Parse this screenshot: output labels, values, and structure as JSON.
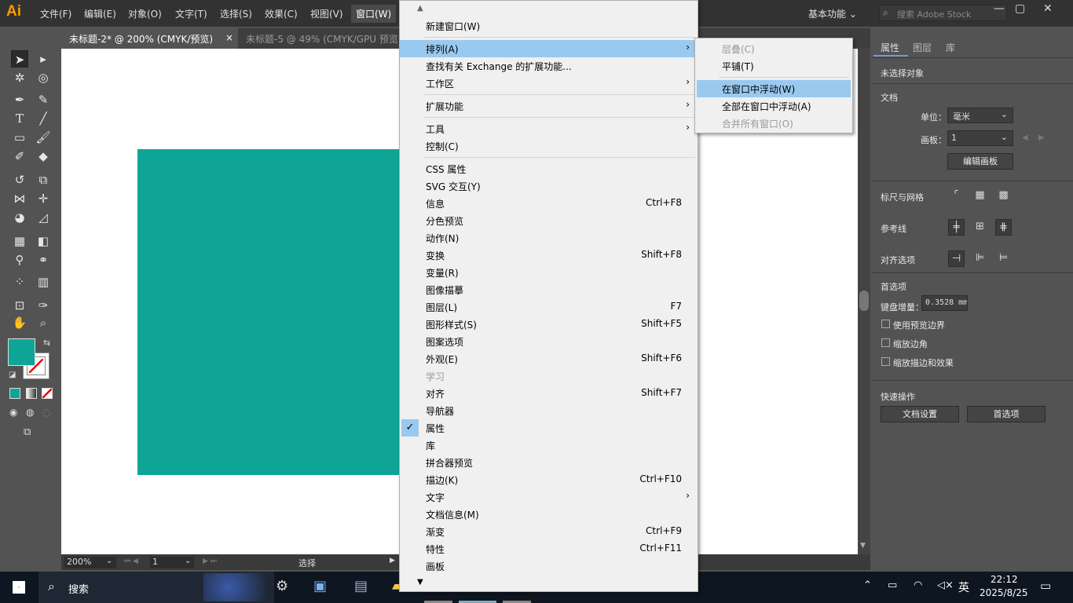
{
  "app": {
    "logo": "Ai"
  },
  "menubar": {
    "items": [
      "文件(F)",
      "编辑(E)",
      "对象(O)",
      "文字(T)",
      "选择(S)",
      "效果(C)",
      "视图(V)",
      "窗口(W)"
    ],
    "workspace": "基本功能",
    "search_placeholder": "搜索 Adobe Stock"
  },
  "tabs": [
    {
      "label": "未标题-2* @ 200% (CMYK/预览)",
      "close": "×"
    },
    {
      "label": "未标题-5 @ 49% (CMYK/GPU 预览"
    }
  ],
  "colors": {
    "fill": "#0ea596",
    "accent": "#99c9ef",
    "menu_bg": "#f0f0f0"
  },
  "statusbar": {
    "zoom": "200%",
    "artboard": "1",
    "tool": "选择"
  },
  "window_menu": {
    "items": [
      {
        "label": "新建窗口(W)",
        "shortcut": "",
        "sub": false
      },
      {
        "label": "排列(A)",
        "shortcut": "",
        "sub": true
      },
      {
        "label": "查找有关 Exchange 的扩展功能...",
        "shortcut": "",
        "sub": false
      },
      {
        "label": "工作区",
        "shortcut": "",
        "sub": true
      },
      {
        "label": "扩展功能",
        "shortcut": "",
        "sub": true
      },
      {
        "label": "工具",
        "shortcut": "",
        "sub": true
      },
      {
        "label": "控制(C)",
        "shortcut": "",
        "sub": false
      },
      {
        "label": "CSS 属性",
        "shortcut": "",
        "sub": false
      },
      {
        "label": "SVG 交互(Y)",
        "shortcut": "",
        "sub": false
      },
      {
        "label": "信息",
        "shortcut": "Ctrl+F8",
        "sub": false
      },
      {
        "label": "分色预览",
        "shortcut": "",
        "sub": false
      },
      {
        "label": "动作(N)",
        "shortcut": "",
        "sub": false
      },
      {
        "label": "变换",
        "shortcut": "Shift+F8",
        "sub": false
      },
      {
        "label": "变量(R)",
        "shortcut": "",
        "sub": false
      },
      {
        "label": "图像描摹",
        "shortcut": "",
        "sub": false
      },
      {
        "label": "图层(L)",
        "shortcut": "F7",
        "sub": false
      },
      {
        "label": "图形样式(S)",
        "shortcut": "Shift+F5",
        "sub": false
      },
      {
        "label": "图案选项",
        "shortcut": "",
        "sub": false
      },
      {
        "label": "外观(E)",
        "shortcut": "Shift+F6",
        "sub": false
      },
      {
        "label": "学习",
        "shortcut": "",
        "sub": false
      },
      {
        "label": "对齐",
        "shortcut": "Shift+F7",
        "sub": false
      },
      {
        "label": "导航器",
        "shortcut": "",
        "sub": false
      },
      {
        "label": "属性",
        "shortcut": "",
        "sub": false
      },
      {
        "label": "库",
        "shortcut": "",
        "sub": false
      },
      {
        "label": "拼合器预览",
        "shortcut": "",
        "sub": false
      },
      {
        "label": "描边(K)",
        "shortcut": "Ctrl+F10",
        "sub": false
      },
      {
        "label": "文字",
        "shortcut": "",
        "sub": true
      },
      {
        "label": "文档信息(M)",
        "shortcut": "",
        "sub": false
      },
      {
        "label": "渐变",
        "shortcut": "Ctrl+F9",
        "sub": false
      },
      {
        "label": "特性",
        "shortcut": "Ctrl+F11",
        "sub": false
      },
      {
        "label": "画板",
        "shortcut": "",
        "sub": false
      }
    ],
    "highlighted": "排列(A)",
    "checked": "属性",
    "disabled": "学习"
  },
  "arrange_submenu": {
    "items": [
      "层叠(C)",
      "平铺(T)",
      "在窗口中浮动(W)",
      "全部在窗口中浮动(A)",
      "合并所有窗口(O)"
    ],
    "highlighted": "在窗口中浮动(W)",
    "disabled": [
      "层叠(C)",
      "合并所有窗口(O)"
    ]
  },
  "properties_panel": {
    "tabs": [
      "属性",
      "图层",
      "库"
    ],
    "no_selection": "未选择对象",
    "document": "文档",
    "units_label": "单位：",
    "units_value": "毫米",
    "artboard_label": "画板：",
    "artboard_value": "1",
    "edit_artboard": "编辑画板",
    "rulers_grids": "标尺与网格",
    "guides": "参考线",
    "align_options": "对齐选项",
    "preferences": "首选项",
    "keyboard_increment_label": "键盘增量：",
    "keyboard_increment_value": "0.3528 mm",
    "checkbox_preview_bounds": "使用预览边界",
    "checkbox_scale_corners": "缩放边角",
    "checkbox_scale_strokes": "缩放描边和效果",
    "quick_actions": "快速操作",
    "doc_setup_btn": "文档设置",
    "prefs_btn": "首选项"
  },
  "taskbar": {
    "search": "搜索",
    "ime": "英",
    "time": "22:12",
    "date": "2025/8/25"
  }
}
